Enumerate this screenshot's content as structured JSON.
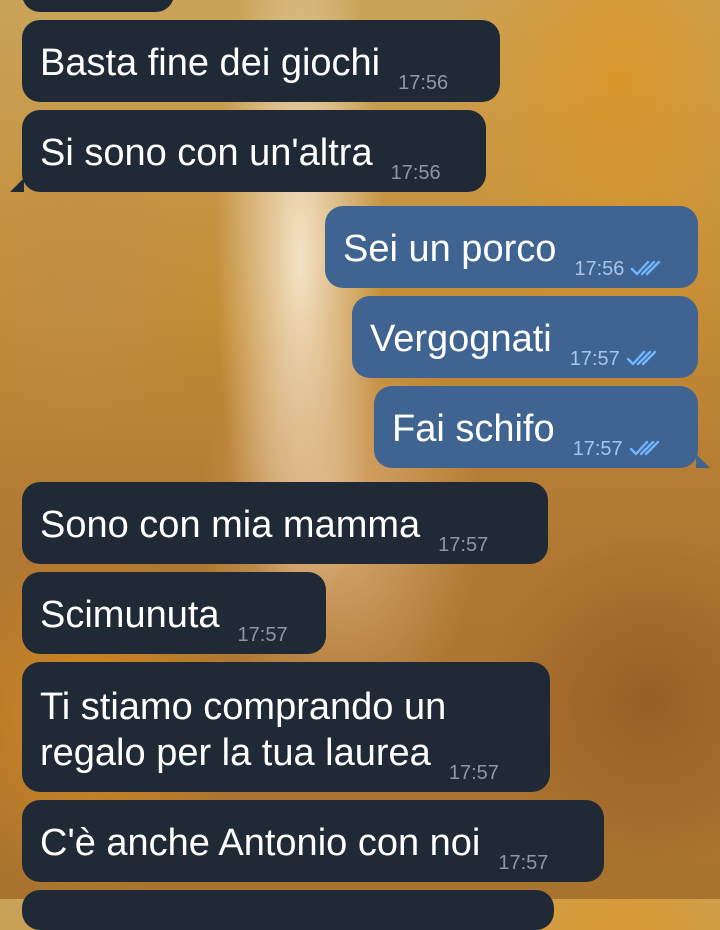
{
  "messages": [
    {
      "id": 0,
      "direction": "in",
      "text": "",
      "time": ""
    },
    {
      "id": 1,
      "direction": "in",
      "text": "Basta fine dei giochi",
      "time": "17:56"
    },
    {
      "id": 2,
      "direction": "in",
      "text": "Si sono con un'altra",
      "time": "17:56"
    },
    {
      "id": 3,
      "direction": "out",
      "text": "Sei un porco",
      "time": "17:56",
      "status": "read"
    },
    {
      "id": 4,
      "direction": "out",
      "text": "Vergognati",
      "time": "17:57",
      "status": "read"
    },
    {
      "id": 5,
      "direction": "out",
      "text": "Fai schifo",
      "time": "17:57",
      "status": "read"
    },
    {
      "id": 6,
      "direction": "in",
      "text": "Sono con mia mamma",
      "time": "17:57"
    },
    {
      "id": 7,
      "direction": "in",
      "text": "Scimunuta",
      "time": "17:57"
    },
    {
      "id": 8,
      "direction": "in",
      "text": "Ti stiamo comprando un\nregalo per la tua laurea",
      "time": "17:57"
    },
    {
      "id": 9,
      "direction": "in",
      "text": "C'è anche Antonio con noi",
      "time": "17:57"
    },
    {
      "id": 10,
      "direction": "in",
      "text": "",
      "time": ""
    }
  ],
  "colors": {
    "incoming_bubble": "#1f2a36",
    "outgoing_bubble": "#3f6492",
    "time_incoming": "#8c97a3",
    "time_outgoing": "#a8c4e8",
    "read_check": "#6fb5ff"
  },
  "icons": {
    "read_status": "double-check-icon"
  }
}
